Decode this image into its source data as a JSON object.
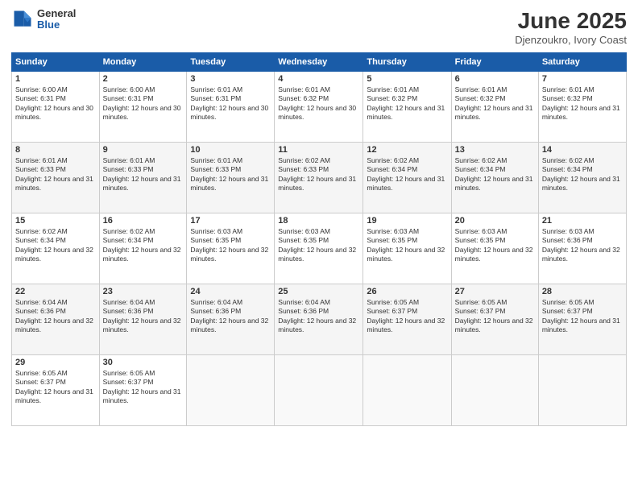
{
  "header": {
    "logo_general": "General",
    "logo_blue": "Blue",
    "title": "June 2025",
    "location": "Djenzoukro, Ivory Coast"
  },
  "days_of_week": [
    "Sunday",
    "Monday",
    "Tuesday",
    "Wednesday",
    "Thursday",
    "Friday",
    "Saturday"
  ],
  "weeks": [
    [
      {
        "day": "1",
        "sunrise": "6:00 AM",
        "sunset": "6:31 PM",
        "daylight": "12 hours and 30 minutes."
      },
      {
        "day": "2",
        "sunrise": "6:00 AM",
        "sunset": "6:31 PM",
        "daylight": "12 hours and 30 minutes."
      },
      {
        "day": "3",
        "sunrise": "6:01 AM",
        "sunset": "6:31 PM",
        "daylight": "12 hours and 30 minutes."
      },
      {
        "day": "4",
        "sunrise": "6:01 AM",
        "sunset": "6:32 PM",
        "daylight": "12 hours and 30 minutes."
      },
      {
        "day": "5",
        "sunrise": "6:01 AM",
        "sunset": "6:32 PM",
        "daylight": "12 hours and 31 minutes."
      },
      {
        "day": "6",
        "sunrise": "6:01 AM",
        "sunset": "6:32 PM",
        "daylight": "12 hours and 31 minutes."
      },
      {
        "day": "7",
        "sunrise": "6:01 AM",
        "sunset": "6:32 PM",
        "daylight": "12 hours and 31 minutes."
      }
    ],
    [
      {
        "day": "8",
        "sunrise": "6:01 AM",
        "sunset": "6:33 PM",
        "daylight": "12 hours and 31 minutes."
      },
      {
        "day": "9",
        "sunrise": "6:01 AM",
        "sunset": "6:33 PM",
        "daylight": "12 hours and 31 minutes."
      },
      {
        "day": "10",
        "sunrise": "6:01 AM",
        "sunset": "6:33 PM",
        "daylight": "12 hours and 31 minutes."
      },
      {
        "day": "11",
        "sunrise": "6:02 AM",
        "sunset": "6:33 PM",
        "daylight": "12 hours and 31 minutes."
      },
      {
        "day": "12",
        "sunrise": "6:02 AM",
        "sunset": "6:34 PM",
        "daylight": "12 hours and 31 minutes."
      },
      {
        "day": "13",
        "sunrise": "6:02 AM",
        "sunset": "6:34 PM",
        "daylight": "12 hours and 31 minutes."
      },
      {
        "day": "14",
        "sunrise": "6:02 AM",
        "sunset": "6:34 PM",
        "daylight": "12 hours and 31 minutes."
      }
    ],
    [
      {
        "day": "15",
        "sunrise": "6:02 AM",
        "sunset": "6:34 PM",
        "daylight": "12 hours and 32 minutes."
      },
      {
        "day": "16",
        "sunrise": "6:02 AM",
        "sunset": "6:34 PM",
        "daylight": "12 hours and 32 minutes."
      },
      {
        "day": "17",
        "sunrise": "6:03 AM",
        "sunset": "6:35 PM",
        "daylight": "12 hours and 32 minutes."
      },
      {
        "day": "18",
        "sunrise": "6:03 AM",
        "sunset": "6:35 PM",
        "daylight": "12 hours and 32 minutes."
      },
      {
        "day": "19",
        "sunrise": "6:03 AM",
        "sunset": "6:35 PM",
        "daylight": "12 hours and 32 minutes."
      },
      {
        "day": "20",
        "sunrise": "6:03 AM",
        "sunset": "6:35 PM",
        "daylight": "12 hours and 32 minutes."
      },
      {
        "day": "21",
        "sunrise": "6:03 AM",
        "sunset": "6:36 PM",
        "daylight": "12 hours and 32 minutes."
      }
    ],
    [
      {
        "day": "22",
        "sunrise": "6:04 AM",
        "sunset": "6:36 PM",
        "daylight": "12 hours and 32 minutes."
      },
      {
        "day": "23",
        "sunrise": "6:04 AM",
        "sunset": "6:36 PM",
        "daylight": "12 hours and 32 minutes."
      },
      {
        "day": "24",
        "sunrise": "6:04 AM",
        "sunset": "6:36 PM",
        "daylight": "12 hours and 32 minutes."
      },
      {
        "day": "25",
        "sunrise": "6:04 AM",
        "sunset": "6:36 PM",
        "daylight": "12 hours and 32 minutes."
      },
      {
        "day": "26",
        "sunrise": "6:05 AM",
        "sunset": "6:37 PM",
        "daylight": "12 hours and 32 minutes."
      },
      {
        "day": "27",
        "sunrise": "6:05 AM",
        "sunset": "6:37 PM",
        "daylight": "12 hours and 32 minutes."
      },
      {
        "day": "28",
        "sunrise": "6:05 AM",
        "sunset": "6:37 PM",
        "daylight": "12 hours and 31 minutes."
      }
    ],
    [
      {
        "day": "29",
        "sunrise": "6:05 AM",
        "sunset": "6:37 PM",
        "daylight": "12 hours and 31 minutes."
      },
      {
        "day": "30",
        "sunrise": "6:05 AM",
        "sunset": "6:37 PM",
        "daylight": "12 hours and 31 minutes."
      },
      null,
      null,
      null,
      null,
      null
    ]
  ]
}
